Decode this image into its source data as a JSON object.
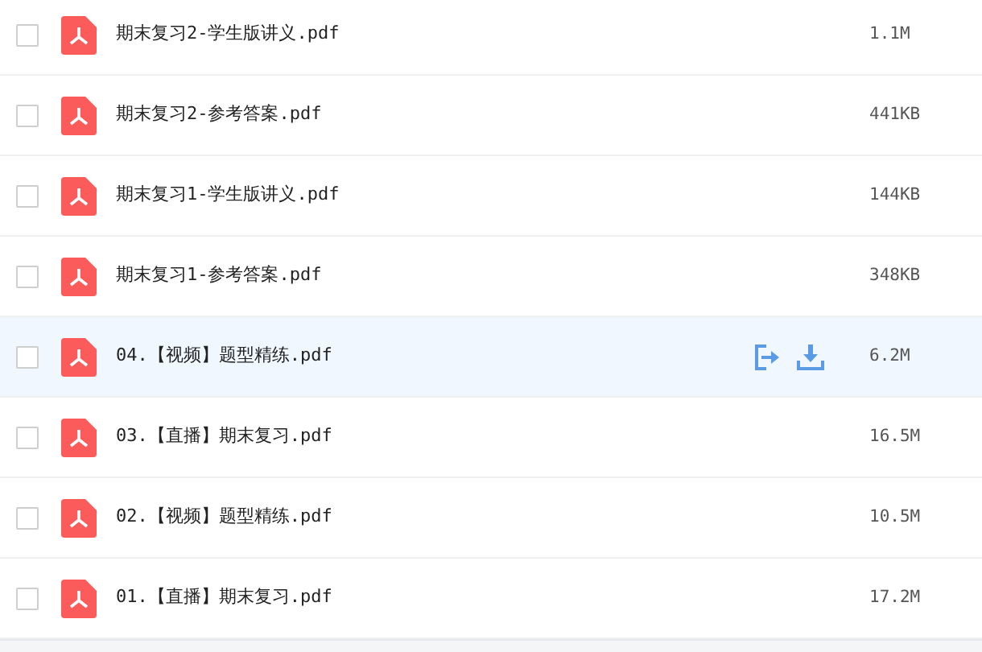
{
  "files": [
    {
      "name": "期末复习2-学生版讲义.pdf",
      "size": "1.1M",
      "checked": false,
      "hovered": false
    },
    {
      "name": "期末复习2-参考答案.pdf",
      "size": "441KB",
      "checked": false,
      "hovered": false
    },
    {
      "name": "期末复习1-学生版讲义.pdf",
      "size": "144KB",
      "checked": false,
      "hovered": false
    },
    {
      "name": "期末复习1-参考答案.pdf",
      "size": "348KB",
      "checked": false,
      "hovered": false
    },
    {
      "name": "04.【视频】题型精练.pdf",
      "size": "6.2M",
      "checked": false,
      "hovered": true
    },
    {
      "name": "03.【直播】期末复习.pdf",
      "size": "16.5M",
      "checked": false,
      "hovered": false
    },
    {
      "name": "02.【视频】题型精练.pdf",
      "size": "10.5M",
      "checked": false,
      "hovered": false
    },
    {
      "name": "01.【直播】期末复习.pdf",
      "size": "17.2M",
      "checked": false,
      "hovered": false
    }
  ]
}
